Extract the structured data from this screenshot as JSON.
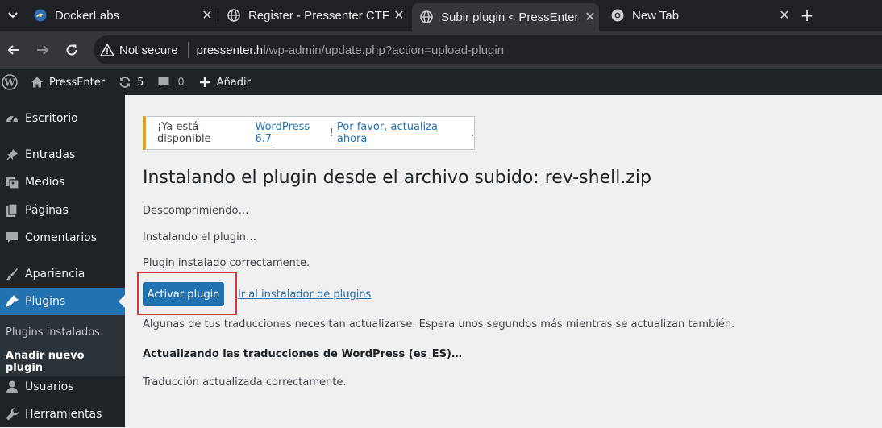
{
  "browser": {
    "tabs": [
      {
        "title": "DockerLabs",
        "favicon": "dockerlabs-icon",
        "active": false
      },
      {
        "title": "Register - Pressenter CTF",
        "favicon": "globe-icon",
        "active": false
      },
      {
        "title": "Subir plugin < PressEnter",
        "favicon": "globe-icon",
        "active": true
      },
      {
        "title": "New Tab",
        "favicon": "chrome-icon",
        "active": false
      }
    ],
    "close_glyph": "✕",
    "new_tab_glyph": "+",
    "security_label": "Not secure",
    "url_host": "pressenter.hl",
    "url_path": "/wp-admin/update.php?action=upload-plugin"
  },
  "adminbar": {
    "site_name": "PressEnter",
    "updates_count": "5",
    "comments_count": "0",
    "new_label": "Añadir"
  },
  "sidebar": {
    "items": [
      {
        "label": "Escritorio",
        "icon": "dashboard-icon"
      },
      {
        "label": "Entradas",
        "icon": "pin-icon"
      },
      {
        "label": "Medios",
        "icon": "media-icon"
      },
      {
        "label": "Páginas",
        "icon": "pages-icon"
      },
      {
        "label": "Comentarios",
        "icon": "comments-icon"
      },
      {
        "label": "Apariencia",
        "icon": "appearance-icon"
      },
      {
        "label": "Plugins",
        "icon": "plugins-icon"
      },
      {
        "label": "Usuarios",
        "icon": "users-icon"
      },
      {
        "label": "Herramientas",
        "icon": "tools-icon"
      }
    ],
    "submenu": [
      "Plugins instalados",
      "Añadir nuevo plugin"
    ]
  },
  "content": {
    "notice_prefix": "¡Ya está disponible ",
    "notice_link1": "WordPress 6.7",
    "notice_mid": "! ",
    "notice_link2": "Por favor, actualiza ahora",
    "notice_suffix": ".",
    "heading": "Instalando el plugin desde el archivo subido: rev-shell.zip",
    "step1": "Descomprimiendo…",
    "step2": "Instalando el plugin…",
    "step3": "Plugin instalado correctamente.",
    "activate_button": "Activar plugin",
    "installer_link": "Ir al instalador de plugins",
    "translations_note": "Algunas de tus traducciones necesitan actualizarse. Espera unos segundos más mientras se actualizan también.",
    "translations_heading": "Actualizando las traducciones de WordPress (es_ES)…",
    "translations_done": "Traducción actualizada correctamente."
  },
  "colors": {
    "wp_blue": "#2271b1",
    "admin_dark": "#1d2327",
    "notice_yellow": "#dba617",
    "highlight_red": "#d63638"
  }
}
